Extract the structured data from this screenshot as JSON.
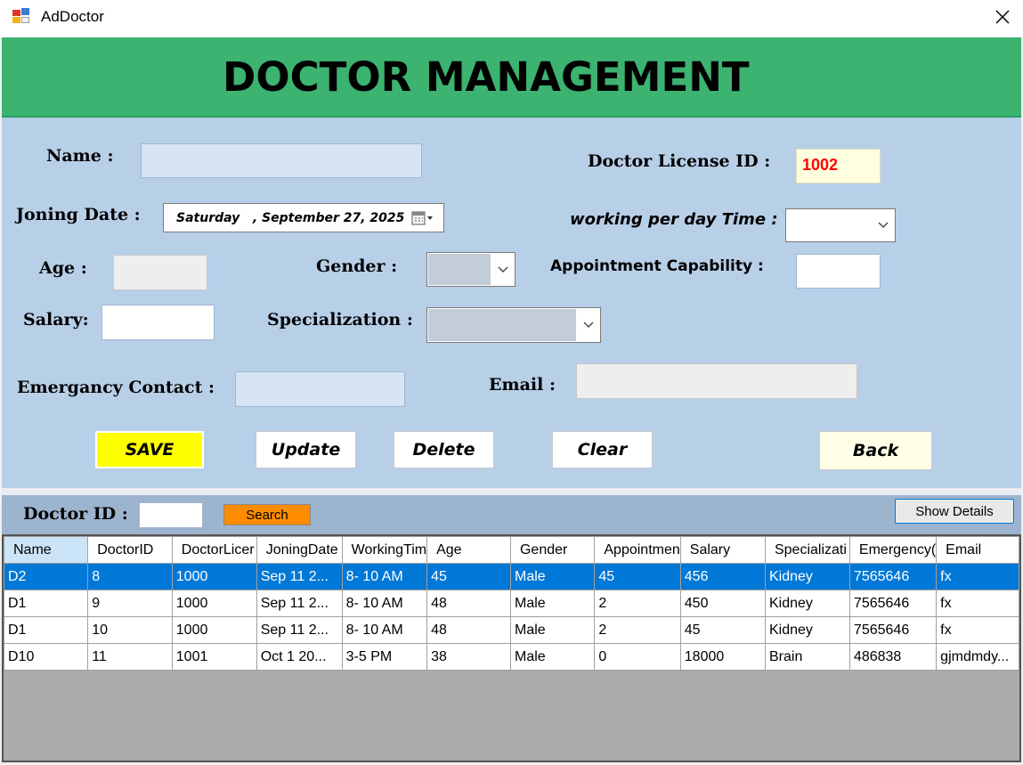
{
  "window": {
    "title": "AdDoctor"
  },
  "header": {
    "title": "DOCTOR MANAGEMENT"
  },
  "form": {
    "name_label": "Name :",
    "name_value": "",
    "license_label": "Doctor License ID  :",
    "license_value": "1002",
    "joining_label": "Joning Date :",
    "joining_value": "Saturday   , September 27, 2025",
    "working_label": "working per day Time :",
    "working_value": "",
    "age_label": "Age :",
    "age_value": "",
    "gender_label": "Gender :",
    "gender_value": "",
    "appointment_label": "Appointment Capability :",
    "appointment_value": "",
    "salary_label": "Salary:",
    "salary_value": "",
    "specialization_label": "Specialization :",
    "specialization_value": "",
    "emergency_label": "Emergancy Contact :",
    "emergency_value": "",
    "email_label": "Email :",
    "email_value": ""
  },
  "buttons": {
    "save": "SAVE",
    "update": "Update",
    "delete": "Delete",
    "clear": "Clear",
    "back": "Back"
  },
  "search": {
    "label": "Doctor ID :",
    "value": "",
    "button": "Search",
    "details_button": "Show Details"
  },
  "table": {
    "columns": [
      "Name",
      "DoctorID",
      "DoctorLicer",
      "JoningDate",
      "WorkingTim",
      "Age",
      "Gender",
      "Appointmen",
      "Salary",
      "Specializati",
      "Emergency(",
      "Email"
    ],
    "rows": [
      [
        "D2",
        "8",
        "1000",
        "Sep 11 2...",
        "8- 10 AM",
        "45",
        "Male",
        "45",
        "456",
        "Kidney",
        "7565646",
        "fx"
      ],
      [
        "D1",
        "9",
        "1000",
        "Sep 11 2...",
        "8- 10 AM",
        "48",
        "Male",
        "2",
        "450",
        "Kidney",
        "7565646",
        "fx"
      ],
      [
        "D1",
        "10",
        "1000",
        "Sep 11 2...",
        "8- 10 AM",
        "48",
        "Male",
        "2",
        "45",
        "Kidney",
        "7565646",
        "fx"
      ],
      [
        "D10",
        "11",
        "1001",
        "Oct  1 20...",
        "3-5 PM",
        "38",
        "Male",
        "0",
        "18000",
        "Brain",
        "486838",
        "gjmdmdy..."
      ]
    ],
    "selected_row": 0
  },
  "colors": {
    "header_bg": "#3cb371",
    "form_bg": "#b8cfe8",
    "save_button": "#ffff00",
    "search_button": "#ff8c00",
    "selected_row": "#0078d7",
    "license_text": "#ff0000"
  },
  "icons": {
    "app": "app-window-icon",
    "close": "close-icon",
    "calendar": "calendar-icon",
    "dropdown": "chevron-down-icon"
  }
}
